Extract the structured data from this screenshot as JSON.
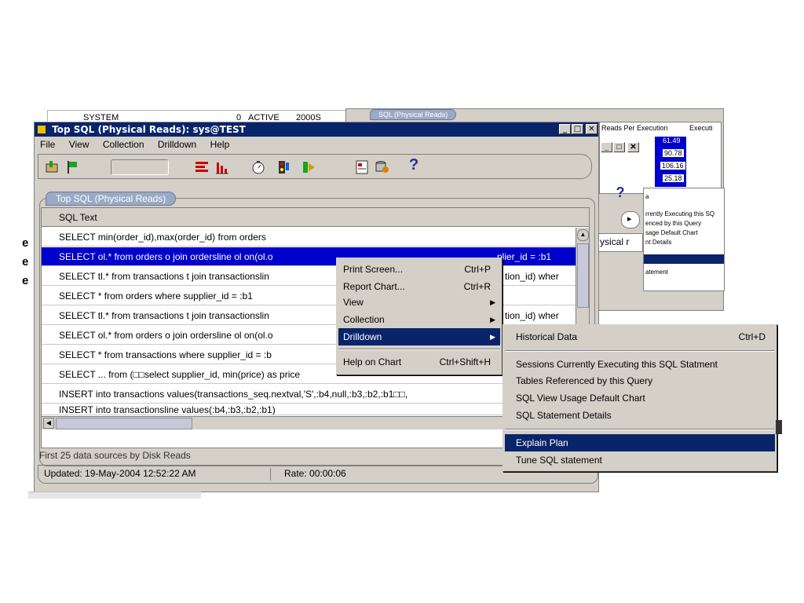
{
  "background": {
    "top_row": {
      "col1": "SYSTEM",
      "col2": "0",
      "col3": "ACTIVE",
      "col4": "2000S"
    },
    "group_label": "SQL (Physical Reads)",
    "right_panel": {
      "col_reads": "Reads Per Execution",
      "col_exec": "Executi",
      "values": [
        "61.49",
        "90.78",
        "106.16",
        "25.18"
      ],
      "help_icon": "?",
      "arrow": "▸",
      "tab": "ysical r",
      "list": [
        "a",
        "rrently Executing this SQ",
        "enced by this Query",
        "sage Default Chart",
        "nt Details"
      ],
      "list_sel": "",
      "list_last": "atement"
    }
  },
  "window": {
    "title": "Top SQL (Physical Reads): sys@TEST",
    "menu": [
      "File",
      "View",
      "Collection",
      "Drilldown",
      "Help"
    ],
    "group_label": "Top SQL (Physical Reads)",
    "column_header": "SQL Text",
    "rows": [
      "SELECT min(order_id),max(order_id) from orders",
      "SELECT ol.* from orders o join ordersline ol on(ol.o",
      "SELECT tl.* from transactions t join transactionslin",
      "SELECT * from orders where supplier_id = :b1",
      "SELECT tl.* from transactions t join transactionslin",
      "SELECT ol.* from orders o join ordersline ol on(ol.o",
      "SELECT * from transactions where supplier_id = :b",
      "SELECT ... from (□□select supplier_id, min(price) as price",
      "INSERT into transactions values(transactions_seq.nextval,'S',:b4,null,:b3,:b2,:b1□□,",
      "INSERT into transactionsline values(:b4,:b3,:b2,:b1)"
    ],
    "right_fragments": {
      "row2": "plier_id = :b1",
      "row3": "tion_id) wher",
      "row5": "tion_id) wher"
    },
    "status_first": "First 25 data sources by Disk Reads",
    "updated": "Updated: 19-May-2004 12:52:22 AM",
    "rate": "Rate: 00:00:06",
    "help_glyph": "?"
  },
  "context_menu": {
    "items": [
      {
        "label": "Print Screen...",
        "shortcut": "Ctrl+P"
      },
      {
        "label": "Report Chart...",
        "shortcut": "Ctrl+R"
      },
      {
        "label": "View",
        "shortcut": ""
      },
      {
        "label": "Collection",
        "shortcut": ""
      },
      {
        "label": "Drilldown",
        "shortcut": ""
      },
      {
        "label": "Help on Chart",
        "shortcut": "Ctrl+Shift+H"
      }
    ]
  },
  "submenu": {
    "items": [
      {
        "label": "Historical Data",
        "shortcut": "Ctrl+D"
      },
      {
        "label": "Sessions Currently Executing this SQL Statment",
        "shortcut": ""
      },
      {
        "label": "Tables Referenced by this Query",
        "shortcut": ""
      },
      {
        "label": "SQL View Usage Default Chart",
        "shortcut": ""
      },
      {
        "label": "SQL Statement Details",
        "shortcut": ""
      },
      {
        "label": "Explain Plan",
        "shortcut": ""
      },
      {
        "label": "Tune SQL statement",
        "shortcut": ""
      }
    ]
  },
  "colors": {
    "selection": "#0000cc",
    "menu_highlight": "#0a246a",
    "title_active": "#0a246a"
  }
}
